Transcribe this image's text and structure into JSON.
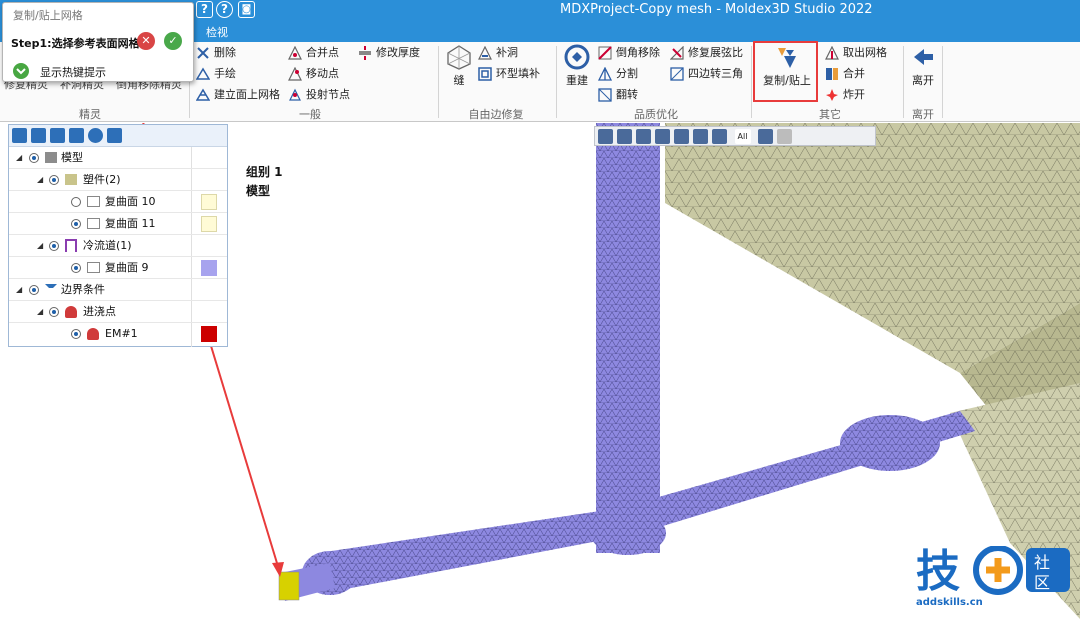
{
  "window": {
    "title": "MDXProject-Copy mesh - Moldex3D Studio 2022"
  },
  "menubar": {
    "tab_view": "检视"
  },
  "ribbon": {
    "wizard_group": {
      "labels": [
        "修复精灵",
        "补洞精灵",
        "倒角移除精灵"
      ],
      "group_label": "精灵"
    },
    "general_group": {
      "items": [
        "删除",
        "手绘",
        "建立面上网格",
        "合并点",
        "移动点",
        "投射节点",
        "修改厚度"
      ],
      "group_label": "一般"
    },
    "free_edge_group": {
      "items": [
        "缝",
        "补洞",
        "环型填补"
      ],
      "group_label": "自由边修复"
    },
    "quality_group": {
      "items": [
        "重建",
        "倒角移除",
        "分割",
        "翻转",
        "修复展弦比",
        "四边转三角"
      ],
      "group_label": "品质优化"
    },
    "other_group": {
      "items": [
        "复制/贴上",
        "取出网格",
        "合并",
        "炸开"
      ],
      "group_label": "其它"
    },
    "leave_group": {
      "items": [
        "离开"
      ],
      "group_label": "离开"
    }
  },
  "popup": {
    "title": "复制/贴上网格",
    "step": "Step1:选择参考表面网格",
    "hint": "显示热键提示"
  },
  "tree": {
    "rows": [
      {
        "label": "模型"
      },
      {
        "label": "塑件(2)"
      },
      {
        "label": "复曲面 10"
      },
      {
        "label": "复曲面 11"
      },
      {
        "label": "冷流道(1)"
      },
      {
        "label": "复曲面 9"
      },
      {
        "label": "边界条件"
      },
      {
        "label": "进浇点"
      },
      {
        "label": "EM#1"
      }
    ]
  },
  "viewport": {
    "group_label": "组别 1",
    "model_label": "模型",
    "toolbar_all": "All"
  },
  "watermark": {
    "logo": "技+社区",
    "url": "addskills.cn"
  },
  "colors": {
    "title_bar": "#2b8fd8",
    "highlight_box": "#e83b3b",
    "runner_mesh": "#8d88e0",
    "part_mesh": "#c8c8a3",
    "gate_marker": "#d7d100",
    "swatch_cream": "#fffbd6",
    "swatch_purple": "#a7a3ee",
    "swatch_red": "#cc0000"
  }
}
